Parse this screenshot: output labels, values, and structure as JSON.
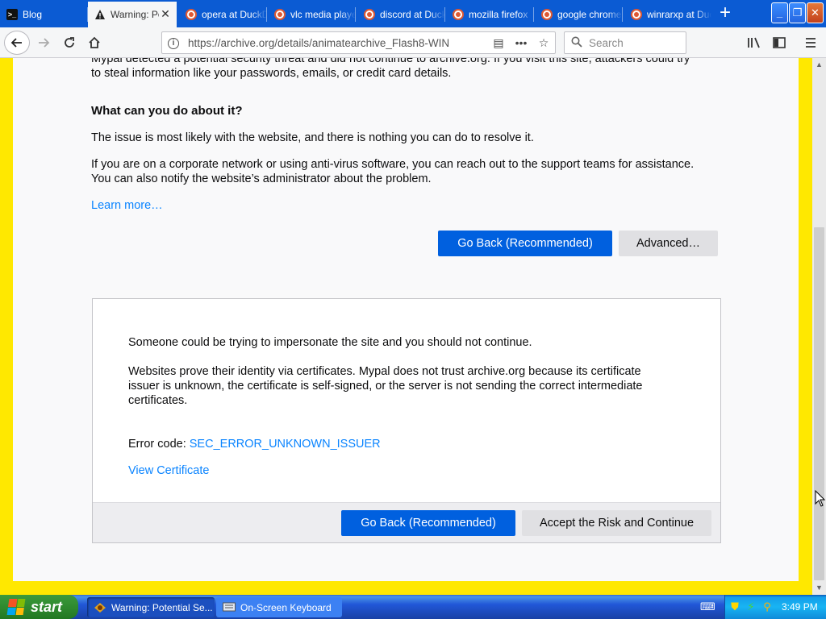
{
  "browser": {
    "tabs": [
      {
        "title": "Blog",
        "icon": "blog-favicon-icon",
        "active": false
      },
      {
        "title": "Warning: Potential Security Risk Ahead",
        "icon": "warning-icon",
        "active": true
      },
      {
        "title": "opera at DuckDuckGo",
        "icon": "duckduckgo-icon",
        "active": false
      },
      {
        "title": "vlc media player",
        "icon": "duckduckgo-icon",
        "active": false
      },
      {
        "title": "discord at DuckDuckGo",
        "icon": "duckduckgo-icon",
        "active": false
      },
      {
        "title": "mozilla firefox",
        "icon": "duckduckgo-icon",
        "active": false
      },
      {
        "title": "google chrome",
        "icon": "duckduckgo-icon",
        "active": false
      },
      {
        "title": "winrarxp at DuckDuckGo",
        "icon": "duckduckgo-icon",
        "active": false
      }
    ],
    "new_tab": "+",
    "url": "https://archive.org/details/animatearchive_Flash8-WIN",
    "search_placeholder": "Search"
  },
  "page": {
    "intro_top": "Mypal detected a potential security threat and did not continue to archive.org. If you visit this site, attackers could try",
    "intro_bottom": "to steal information like your passwords, emails, or credit card details.",
    "heading": "What can you do about it?",
    "para1": "The issue is most likely with the website, and there is nothing you can do to resolve it.",
    "para2_line1": "If you are on a corporate network or using anti-virus software, you can reach out to the support teams for assistance.",
    "para2_line2": "You can also notify the website’s administrator about the problem.",
    "learn_more": "Learn more…",
    "go_back": "Go Back (Recommended)",
    "advanced": "Advanced…",
    "details": {
      "line1": "Someone could be trying to impersonate the site and you should not continue.",
      "para_line1": "Websites prove their identity via certificates. Mypal does not trust archive.org because its certificate",
      "para_line2": "issuer is unknown, the certificate is self-signed, or the server is not sending the correct intermediate",
      "para_line3": "certificates.",
      "error_label": "Error code:",
      "error_code": "SEC_ERROR_UNKNOWN_ISSUER",
      "view_certificate": "View Certificate",
      "go_back": "Go Back (Recommended)",
      "accept": "Accept the Risk and Continue"
    }
  },
  "taskbar": {
    "start": "start",
    "items": [
      {
        "label": "Warning: Potential Se...",
        "active": true
      },
      {
        "label": "On-Screen Keyboard",
        "active": false
      }
    ],
    "clock": "3:49 PM"
  },
  "colors": {
    "tabstrip": "#0b5bd3",
    "primary_button": "#0060df",
    "link": "#0a84ff",
    "page_background": "#f9f9fa",
    "frame_border": "#ffe800"
  }
}
